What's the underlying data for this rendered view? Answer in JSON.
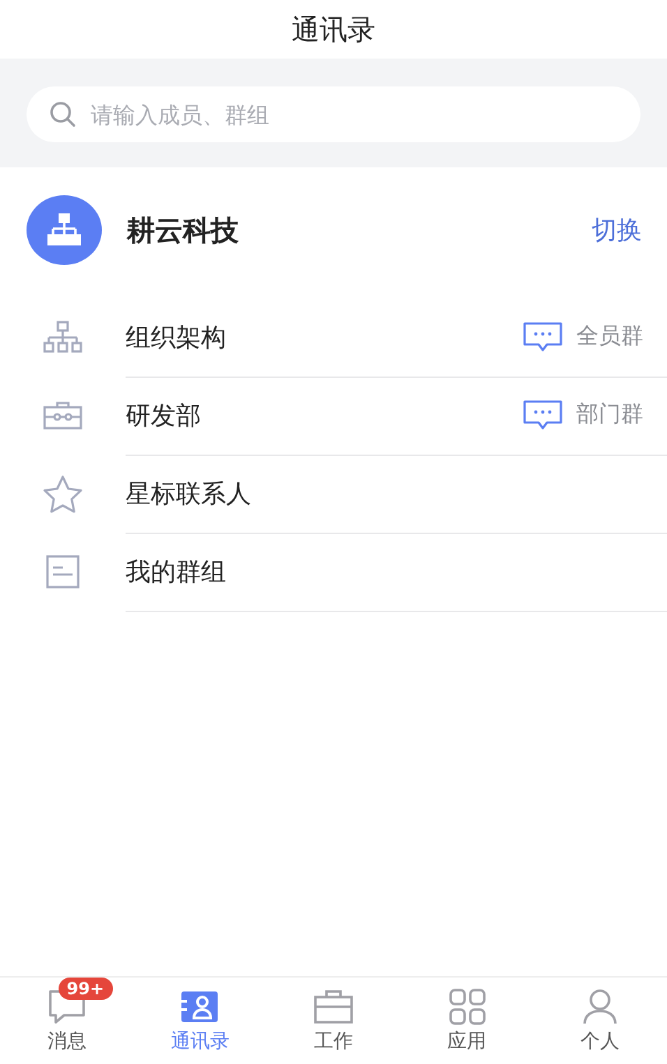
{
  "header": {
    "title": "通讯录"
  },
  "search": {
    "placeholder": "请输入成员、群组"
  },
  "company": {
    "name": "耕云科技",
    "action": "切换"
  },
  "items": [
    {
      "kind": "org",
      "label": "组织架构",
      "group": "全员群"
    },
    {
      "kind": "briefcase",
      "label": "研发部",
      "group": "部门群"
    },
    {
      "kind": "star",
      "label": "星标联系人"
    },
    {
      "kind": "doc",
      "label": "我的群组"
    }
  ],
  "tabbar": [
    {
      "kind": "chat",
      "label": "消息",
      "badge": "99+",
      "selected": false
    },
    {
      "kind": "contacts",
      "label": "通讯录",
      "selected": true
    },
    {
      "kind": "work",
      "label": "工作",
      "selected": false
    },
    {
      "kind": "apps",
      "label": "应用",
      "selected": false
    },
    {
      "kind": "person",
      "label": "个人",
      "selected": false
    }
  ]
}
